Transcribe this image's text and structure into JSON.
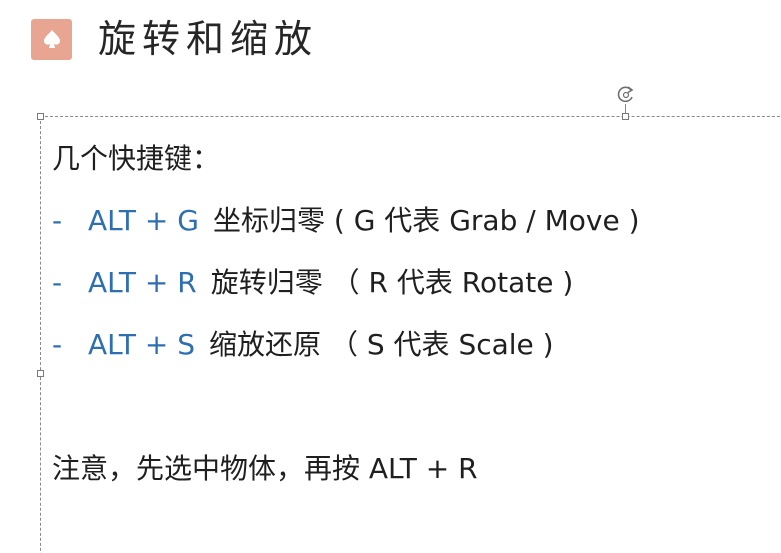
{
  "slide": {
    "title": "旋转和缩放",
    "intro": "几个快捷键：",
    "items": [
      {
        "bullet": "-",
        "key": "ALT + G",
        "desc": "坐标归零",
        "paren": " ( G 代表 Grab / Move )"
      },
      {
        "bullet": "-",
        "key": "ALT + R",
        "desc": "旋转归零",
        "paren": " （ R 代表 Rotate )"
      },
      {
        "bullet": "-",
        "key": "ALT + S",
        "desc": "缩放还原",
        "paren": " （ S 代表 Scale )"
      }
    ],
    "note": "注意，先选中物体，再按 ALT + R"
  },
  "colors": {
    "badge": "#e8a591",
    "accent": "#2d6fb0"
  },
  "icons": {
    "title_badge": "spade-icon",
    "rotate": "rotate-icon"
  }
}
